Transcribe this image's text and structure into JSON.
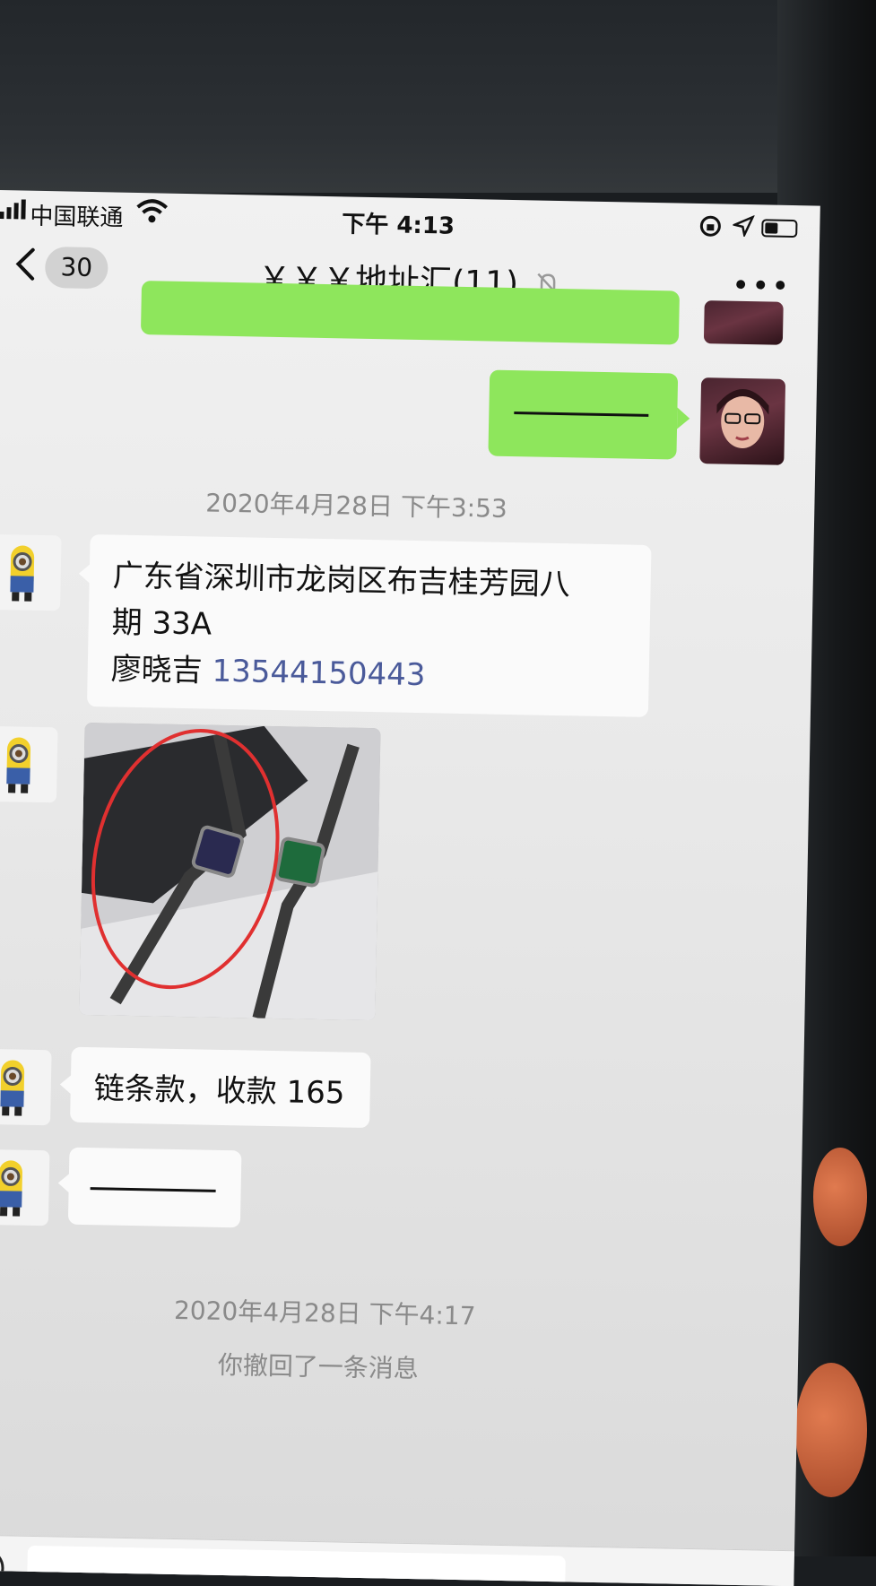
{
  "status_bar": {
    "carrier": "中国联通",
    "time": "下午 4:13"
  },
  "nav": {
    "unread_count": "30",
    "title": "￥￥￥地址汇(11)"
  },
  "messages": {
    "timestamp_1": "2020年4月28日 下午3:53",
    "address_line1": "广东省深圳市龙岗区布吉桂芳园八",
    "address_line2": "期 33A",
    "address_name": "廖晓吉",
    "address_phone": "13544150443",
    "chain_text": "链条款，收款 165",
    "timestamp_2": "2020年4月28日 下午4:17",
    "recall_notice": "你撤回了一条消息"
  },
  "icons": {
    "back": "back-chevron-icon",
    "mute": "bell-muted-icon",
    "more": "more-dots-icon",
    "voice": "voice-icon"
  },
  "colors": {
    "sent_bubble": "#8ee65c",
    "received_bubble": "#fafafa",
    "phone_link": "#4a5a9a"
  }
}
